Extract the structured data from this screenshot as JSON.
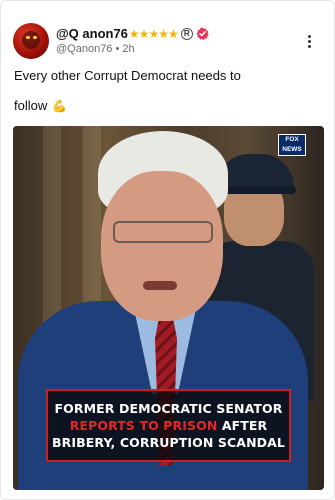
{
  "author": {
    "display_name": "@Q anon76",
    "stars": "★★★★★",
    "registered_mark": "R",
    "handle": "@Qanon76",
    "separator": "•",
    "time": "2h"
  },
  "post": {
    "text_line1": "Every other Corrupt Democrat needs to",
    "text_line2": "follow",
    "emoji": "💪"
  },
  "media": {
    "network_logo_line1": "FOX",
    "network_logo_line2": "NEWS",
    "headline_line1": "FORMER DEMOCRATIC SENATOR",
    "headline_highlight": "REPORTS TO PRISON",
    "headline_after": "AFTER",
    "headline_line3": "BRIBERY, CORRUPTION SCANDAL"
  },
  "colors": {
    "star": "#f4b400",
    "verified_badge": "#e9355a",
    "highlight_red": "#e32626",
    "banner_border": "#cc1e1e"
  },
  "icons": [
    "avatar-icon",
    "verified-badge-icon",
    "registered-icon",
    "more-options-icon",
    "flexed-biceps-emoji",
    "fox-news-logo"
  ]
}
